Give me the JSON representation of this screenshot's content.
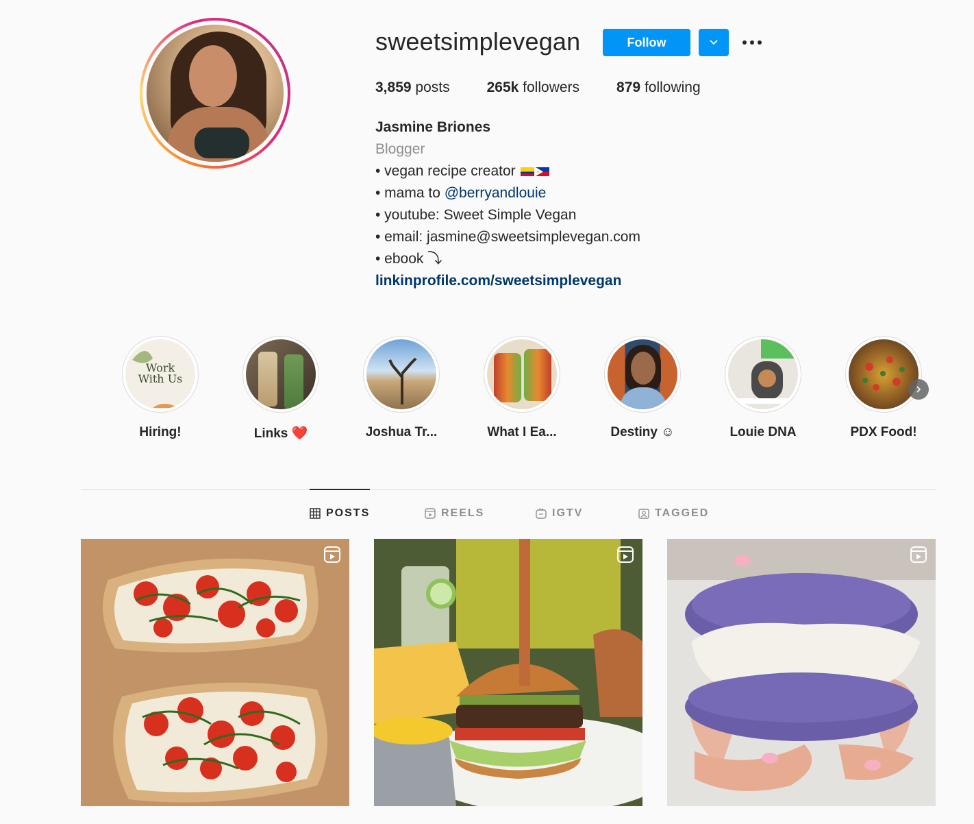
{
  "profile": {
    "username": "sweetsimplevegan",
    "follow_label": "Follow",
    "stats": {
      "posts_count": "3,859",
      "posts_label": "posts",
      "followers_count": "265k",
      "followers_label": "followers",
      "following_count": "879",
      "following_label": "following"
    },
    "bio": {
      "name": "Jasmine Briones",
      "category": "Blogger",
      "line1": "• vegan recipe creator",
      "line2_prefix": "• mama to ",
      "line2_mention": "@berryandlouie",
      "line3": "• youtube: Sweet Simple Vegan",
      "line4": "• email: jasmine@sweetsimplevegan.com",
      "line5": "• ebook",
      "line5_arrow": "⤵",
      "link": "linkinprofile.com/sweetsimplevegan"
    }
  },
  "highlights": [
    {
      "label": "Hiring!",
      "cover_text_1": "Work",
      "cover_text_2": "With Us"
    },
    {
      "label": "Links ❤️"
    },
    {
      "label": "Joshua Tr..."
    },
    {
      "label": "What I Ea..."
    },
    {
      "label": "Destiny ☺"
    },
    {
      "label": "Louie DNA"
    },
    {
      "label": "PDX Food!"
    }
  ],
  "tabs": [
    {
      "label": "POSTS",
      "icon": "grid-icon",
      "active": true
    },
    {
      "label": "REELS",
      "icon": "reels-icon",
      "active": false
    },
    {
      "label": "IGTV",
      "icon": "igtv-icon",
      "active": false
    },
    {
      "label": "TAGGED",
      "icon": "tagged-icon",
      "active": false
    }
  ],
  "colors": {
    "accent": "#0095f6",
    "link": "#00376b",
    "muted": "#8e8e8e"
  }
}
